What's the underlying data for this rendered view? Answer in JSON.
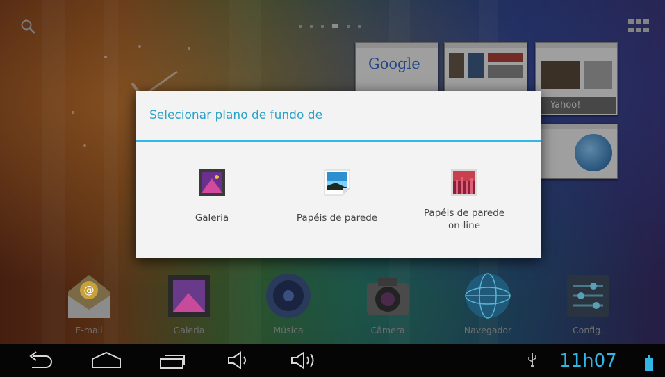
{
  "dialog": {
    "title": "Selecionar plano de fundo de",
    "options": [
      {
        "label": "Galeria",
        "icon": "gallery-icon"
      },
      {
        "label": "Papéis de parede",
        "icon": "wallpapers-icon"
      },
      {
        "label_line1": "Papéis de parede",
        "label_line2": "on-line",
        "icon": "live-wallpapers-icon"
      }
    ]
  },
  "recent_thumbnails": [
    {
      "name": "Google",
      "logo": "Google"
    },
    {
      "name": "news-site"
    },
    {
      "name": "yahoo",
      "label": "Yahoo!"
    },
    {
      "name": "globe-site"
    }
  ],
  "dock": [
    {
      "label": "E-mail",
      "icon": "email-icon"
    },
    {
      "label": "Galeria",
      "icon": "gallery-icon"
    },
    {
      "label": "Música",
      "icon": "music-icon"
    },
    {
      "label": "Câmera",
      "icon": "camera-icon"
    },
    {
      "label": "Navegador",
      "icon": "globe-icon"
    },
    {
      "label": "Config.",
      "icon": "settings-icon"
    }
  ],
  "status": {
    "time": "11h07",
    "accent": "#33b5e5"
  },
  "navbar": {
    "buttons": [
      "back-icon",
      "home-icon",
      "recent-apps-icon",
      "volume-down-icon",
      "volume-up-icon"
    ]
  }
}
